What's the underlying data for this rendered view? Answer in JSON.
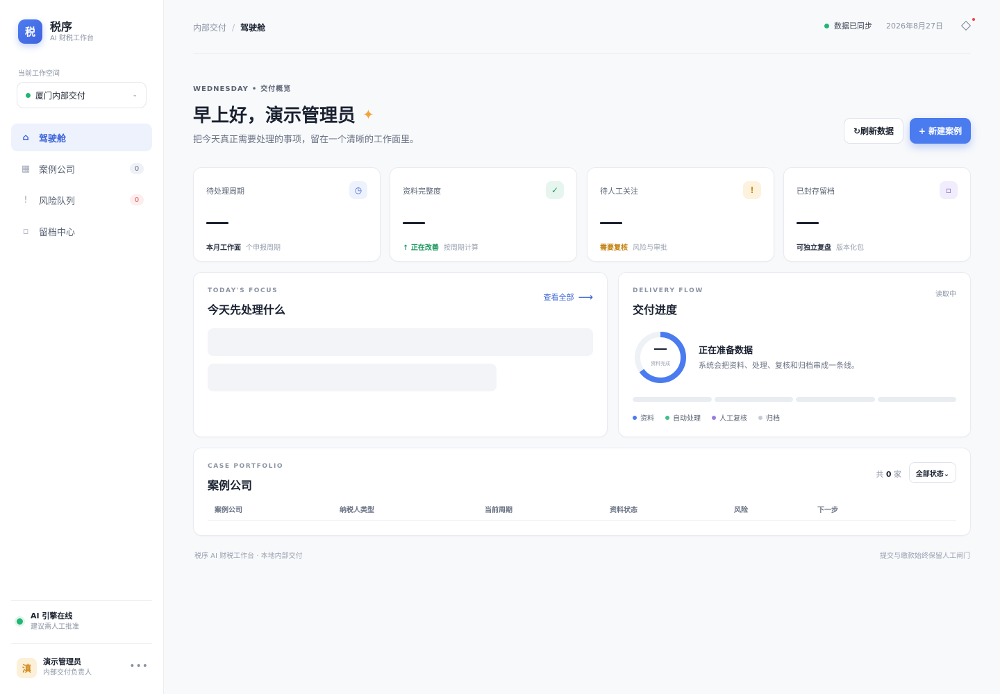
{
  "brand": {
    "logo": "税",
    "title": "税序",
    "subtitle": "AI 财税工作台"
  },
  "workspace": {
    "label": "当前工作空间",
    "selected": "厦门内部交付",
    "chevron": "⌄"
  },
  "sidebar": {
    "items": [
      {
        "label": "驾驶舱",
        "icon": "home-icon",
        "glyph": "⌂",
        "active": true
      },
      {
        "label": "案例公司",
        "icon": "building-icon",
        "glyph": "▦",
        "badge": "0"
      },
      {
        "label": "风险队列",
        "icon": "alert-icon",
        "glyph": "!",
        "badge": "0"
      },
      {
        "label": "留档中心",
        "icon": "archive-icon",
        "glyph": "▫"
      }
    ],
    "ai": {
      "title": "AI 引擎在线",
      "subtitle": "建议需人工批准"
    },
    "user": {
      "avatar": "滇",
      "name": "演示管理员",
      "role": "内部交付负责人",
      "more": "•••"
    }
  },
  "topbar": {
    "breadcrumb": [
      "内部交付",
      "驾驶舱"
    ],
    "separator": "/",
    "sync_status": "数据已同步",
    "date": "2026年8月27日",
    "notification_icon": "diamond-icon"
  },
  "hero": {
    "eyebrow_day": "WEDNESDAY",
    "eyebrow_bullet": "•",
    "eyebrow_section": "交付概览",
    "greeting": "早上好，演示管理员",
    "sparkle": "✦",
    "subtitle": "把今天真正需要处理的事项，留在一个清晰的工作面里。",
    "refresh_label": "↻刷新数据",
    "new_case_label": "+ 新建案例"
  },
  "stats": [
    {
      "label": "待处理周期",
      "icon": "clock-icon",
      "glyph": "◷",
      "foot_strong": "本月工作面",
      "foot_note": "个申报周期",
      "accent": "#3a63d8",
      "tint": "#edf2fd"
    },
    {
      "label": "资料完整度",
      "icon": "check-icon",
      "glyph": "✓",
      "foot_strong": "↑ 正在改善",
      "foot_note": "按周期计算",
      "accent": "#1f9a62",
      "tint": "#e6f6ee"
    },
    {
      "label": "待人工关注",
      "icon": "warning-icon",
      "glyph": "!",
      "foot_strong": "需要复核",
      "foot_note": "风险与审批",
      "accent": "#d18a1e",
      "tint": "#fdf2de"
    },
    {
      "label": "已封存留档",
      "icon": "archive-icon",
      "glyph": "▫",
      "foot_strong": "可独立复盘",
      "foot_note": "版本化包",
      "accent": "#7b5cd6",
      "tint": "#f1edfc"
    }
  ],
  "focus": {
    "eyebrow": "TODAY'S FOCUS",
    "title": "今天先处理什么",
    "see_all": "查看全部",
    "arrow": "⟶"
  },
  "delivery": {
    "eyebrow": "DELIVERY FLOW",
    "title": "交付进度",
    "status": "读取中",
    "donut_label": "资料完成",
    "prep_title": "正在准备数据",
    "prep_sub": "系统会把资料、处理、复核和归档串成一条线。",
    "legend": [
      {
        "label": "资料",
        "color": "#4a7bef"
      },
      {
        "label": "自动处理",
        "color": "#3fbf8b"
      },
      {
        "label": "人工复核",
        "color": "#9b7be0"
      },
      {
        "label": "归档",
        "color": "#c5cad3"
      }
    ]
  },
  "portfolio": {
    "eyebrow": "CASE PORTFOLIO",
    "title": "案例公司",
    "count_prefix": "共",
    "count": "0",
    "count_suffix": "家",
    "filter": "全部状态⌄",
    "columns": [
      "案例公司",
      "纳税人类型",
      "当前周期",
      "资料状态",
      "风险",
      "下一步"
    ]
  },
  "footer": {
    "left": "税序 AI 财税工作台 · 本地内部交付",
    "right": "提交与缴款始终保留人工闸门"
  },
  "colors": {
    "accent": "#4a7bef",
    "success": "#22b573"
  }
}
